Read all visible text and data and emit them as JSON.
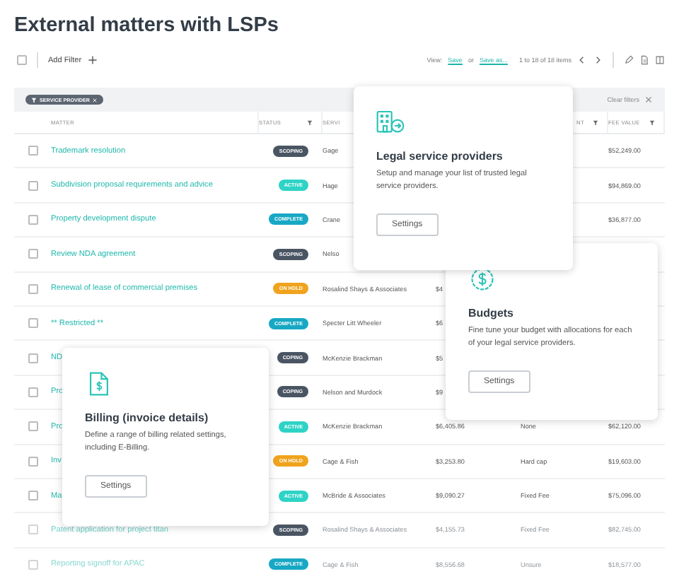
{
  "title": "External matters with LSPs",
  "toolbar": {
    "checked": false,
    "add_filter": "Add Filter",
    "view_label": "View:",
    "save": "Save",
    "or": "or",
    "save_as": "Save as...",
    "range": "1 to 18 of 18 items"
  },
  "filters": {
    "chips": [
      {
        "label": "SERVICE PROVIDER"
      }
    ],
    "clear": "Clear filters"
  },
  "table": {
    "columns": [
      {
        "label": "MATTER",
        "filter": false
      },
      {
        "label": "STATUS",
        "filter": true
      },
      {
        "label": "SERVI",
        "filter": false
      },
      {
        "label": "NT",
        "filter": true
      },
      {
        "label": "FEE VALUE",
        "filter": true
      }
    ],
    "rows": [
      {
        "checked": false,
        "matter": "Trademark resolution",
        "status": {
          "label": "SCOPING",
          "color": "#4a5563"
        },
        "provider": "Gage",
        "fee": "$52,249.00"
      },
      {
        "checked": false,
        "matter": "Subdivision proposal requirements and advice",
        "status": {
          "label": "ACTIVE",
          "color": "#2ed3c6"
        },
        "provider": "Hage",
        "fee": "$94,869.00"
      },
      {
        "checked": false,
        "matter": "Property development dispute",
        "status": {
          "label": "COMPLETE",
          "color": "#17a8c4"
        },
        "provider": "Crane",
        "fee": "$36,877.00"
      },
      {
        "checked": false,
        "matter": "Review NDA agreement",
        "status": {
          "label": "SCOPING",
          "color": "#4a5563"
        },
        "provider": "Nelso"
      },
      {
        "checked": false,
        "matter": "Renewal of lease of commercial premises",
        "status": {
          "label": "ON HOLD",
          "color": "#f0a31c"
        },
        "provider": "Rosalind Shays & Associates",
        "amount": "$4"
      },
      {
        "checked": false,
        "matter": "** Restricted **",
        "status": {
          "label": "COMPLETE",
          "color": "#17a8c4"
        },
        "provider": "Specter Litt Wheeler",
        "amount": "$6"
      },
      {
        "checked": false,
        "matter": "ND",
        "status": {
          "label": "COPING",
          "color": "#4a5563"
        },
        "provider": "McKenzie Brackman",
        "amount": "$5"
      },
      {
        "checked": false,
        "matter": "Pro",
        "status": {
          "label": "COPING",
          "color": "#4a5563"
        },
        "provider": "Nelson and Murdock",
        "amount": "$9"
      },
      {
        "checked": false,
        "matter": "Pro",
        "status": {
          "label": "ACTIVE",
          "color": "#2ed3c6"
        },
        "provider": "McKenzie Brackman",
        "amount": "$6,405.86",
        "cap": "None",
        "fee": "$62,120.00"
      },
      {
        "checked": false,
        "matter": "Inv",
        "status": {
          "label": "ON HOLD",
          "color": "#f0a31c"
        },
        "provider": "Cage & Fish",
        "amount": "$3,253.80",
        "cap": "Hard cap",
        "fee": "$19,603.00"
      },
      {
        "checked": false,
        "matter": "Ma",
        "status": {
          "label": "ACTIVE",
          "color": "#2ed3c6"
        },
        "provider": "McBride & Associates",
        "amount": "$9,090.27",
        "cap": "Fixed Fee",
        "fee": "$75,096.00"
      },
      {
        "checked": false,
        "matter": "Patent application for project titan",
        "status": {
          "label": "SCOPING",
          "color": "#4a5563"
        },
        "provider": "Rosalind Shays & Associates",
        "amount": "$4,155.73",
        "cap": "Fixed Fee",
        "fee": "$82,745.00"
      },
      {
        "checked": false,
        "matter": "Reporting signoff for APAC",
        "status": {
          "label": "COMPLETE",
          "color": "#17a8c4"
        },
        "provider": "Cage & Fish",
        "amount": "$8,556.68",
        "cap": "Unsure",
        "fee": "$18,577.00"
      }
    ]
  },
  "cards": [
    {
      "kind": "providers",
      "title": "Legal service providers",
      "description": "Setup and manage your list of trusted legal service providers.",
      "button": "Settings"
    },
    {
      "kind": "budgets",
      "title": "Budgets",
      "description": "Fine tune your budget with allocations for each of your legal service providers.",
      "button": "Settings"
    },
    {
      "kind": "billing",
      "title": "Billing (invoice details)",
      "description": "Define a range of billing related settings, including E-Billing.",
      "button": "Settings"
    }
  ]
}
